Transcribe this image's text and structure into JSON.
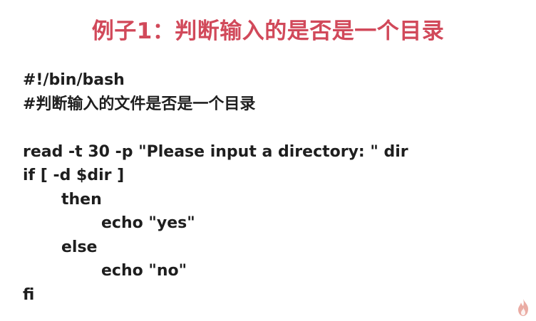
{
  "slide": {
    "title": "例子1：判断输入的是否是一个目录",
    "code_lines": [
      "#!/bin/bash",
      "#判断输入的文件是否是一个目录",
      "",
      "read -t 30 -p \"Please input a directory: \" dir",
      "if [ -d $dir ]",
      "then",
      "echo \"yes\"",
      "else",
      "echo \"no\"",
      "fi"
    ]
  },
  "colors": {
    "title": "#d1495a",
    "text": "#1e1e1e",
    "logo": "#e8a39a"
  },
  "icons": {
    "corner_logo": "flame-logo-icon"
  }
}
